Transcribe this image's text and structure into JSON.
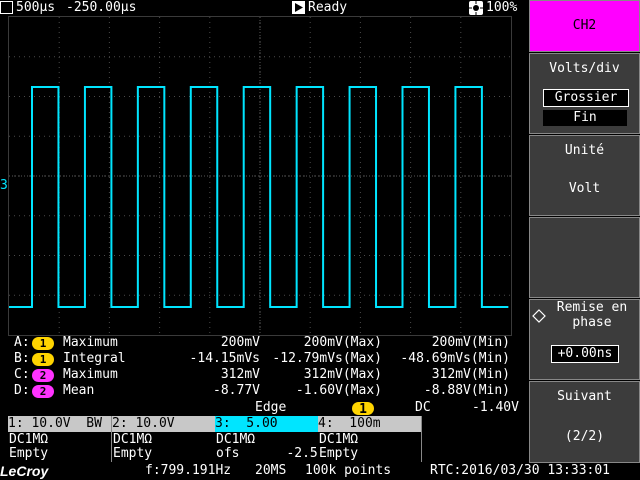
{
  "topbar": {
    "timebase": "500µs",
    "delay": "-250.00µs",
    "status": "Ready",
    "battery": "100%"
  },
  "channel_marker": "3",
  "measurements": [
    {
      "letter": "A:",
      "src": "1",
      "name": "Maximum",
      "v1": "200mV",
      "v2": "200mV(Max)",
      "v3": "200mV(Min)"
    },
    {
      "letter": "B:",
      "src": "1",
      "name": "Integral",
      "v1": "-14.15mVs",
      "v2": "-12.79mVs(Max)",
      "v3": "-48.69mVs(Min)"
    },
    {
      "letter": "C:",
      "src": "2",
      "name": "Maximum",
      "v1": "312mV",
      "v2": "312mV(Max)",
      "v3": "312mV(Min)"
    },
    {
      "letter": "D:",
      "src": "2",
      "name": "Mean",
      "v1": "-8.77V",
      "v2": "-1.60V(Max)",
      "v3": "-8.88V(Min)"
    }
  ],
  "trigger": {
    "type": "Edge",
    "source": "1",
    "coupling": "DC",
    "level": "-1.40V"
  },
  "channels": [
    {
      "head": "1: 10.0V  BW",
      "coupling": "DC1MΩ",
      "state": "Empty"
    },
    {
      "head": "2: 10.0V",
      "coupling": "DC1MΩ",
      "state": "Empty"
    },
    {
      "head": "3:  5.00",
      "coupling": "DC1MΩ",
      "state": "ofs      -2.50"
    },
    {
      "head": "4:  100m",
      "coupling": "DC1MΩ",
      "state": "Empty"
    }
  ],
  "status": {
    "brand": "LeCroy",
    "freq": "f:799.191Hz",
    "rate": "20MS",
    "points": "100k points",
    "rtc": "RTC:2016/03/30 13:33:01"
  },
  "menu": {
    "channel": "CH2",
    "volts_title": "Volts/div",
    "volts_opt1": "Grossier",
    "volts_opt2": "Fin",
    "unit_title": "Unité",
    "unit_value": "Volt",
    "offset_title": "Remise en phase",
    "offset_value": "+0.00ns",
    "next_title": "Suivant",
    "next_page": "(2/2)"
  },
  "colors": {
    "trace": "#00e5ff",
    "ch1": "#ffd400",
    "ch2": "#ff33ff",
    "menu_active": "#ff00ff"
  },
  "chart_data": {
    "type": "line",
    "series": [
      {
        "waveform": "square",
        "cycles": 9,
        "duty": 0.5
      }
    ]
  }
}
